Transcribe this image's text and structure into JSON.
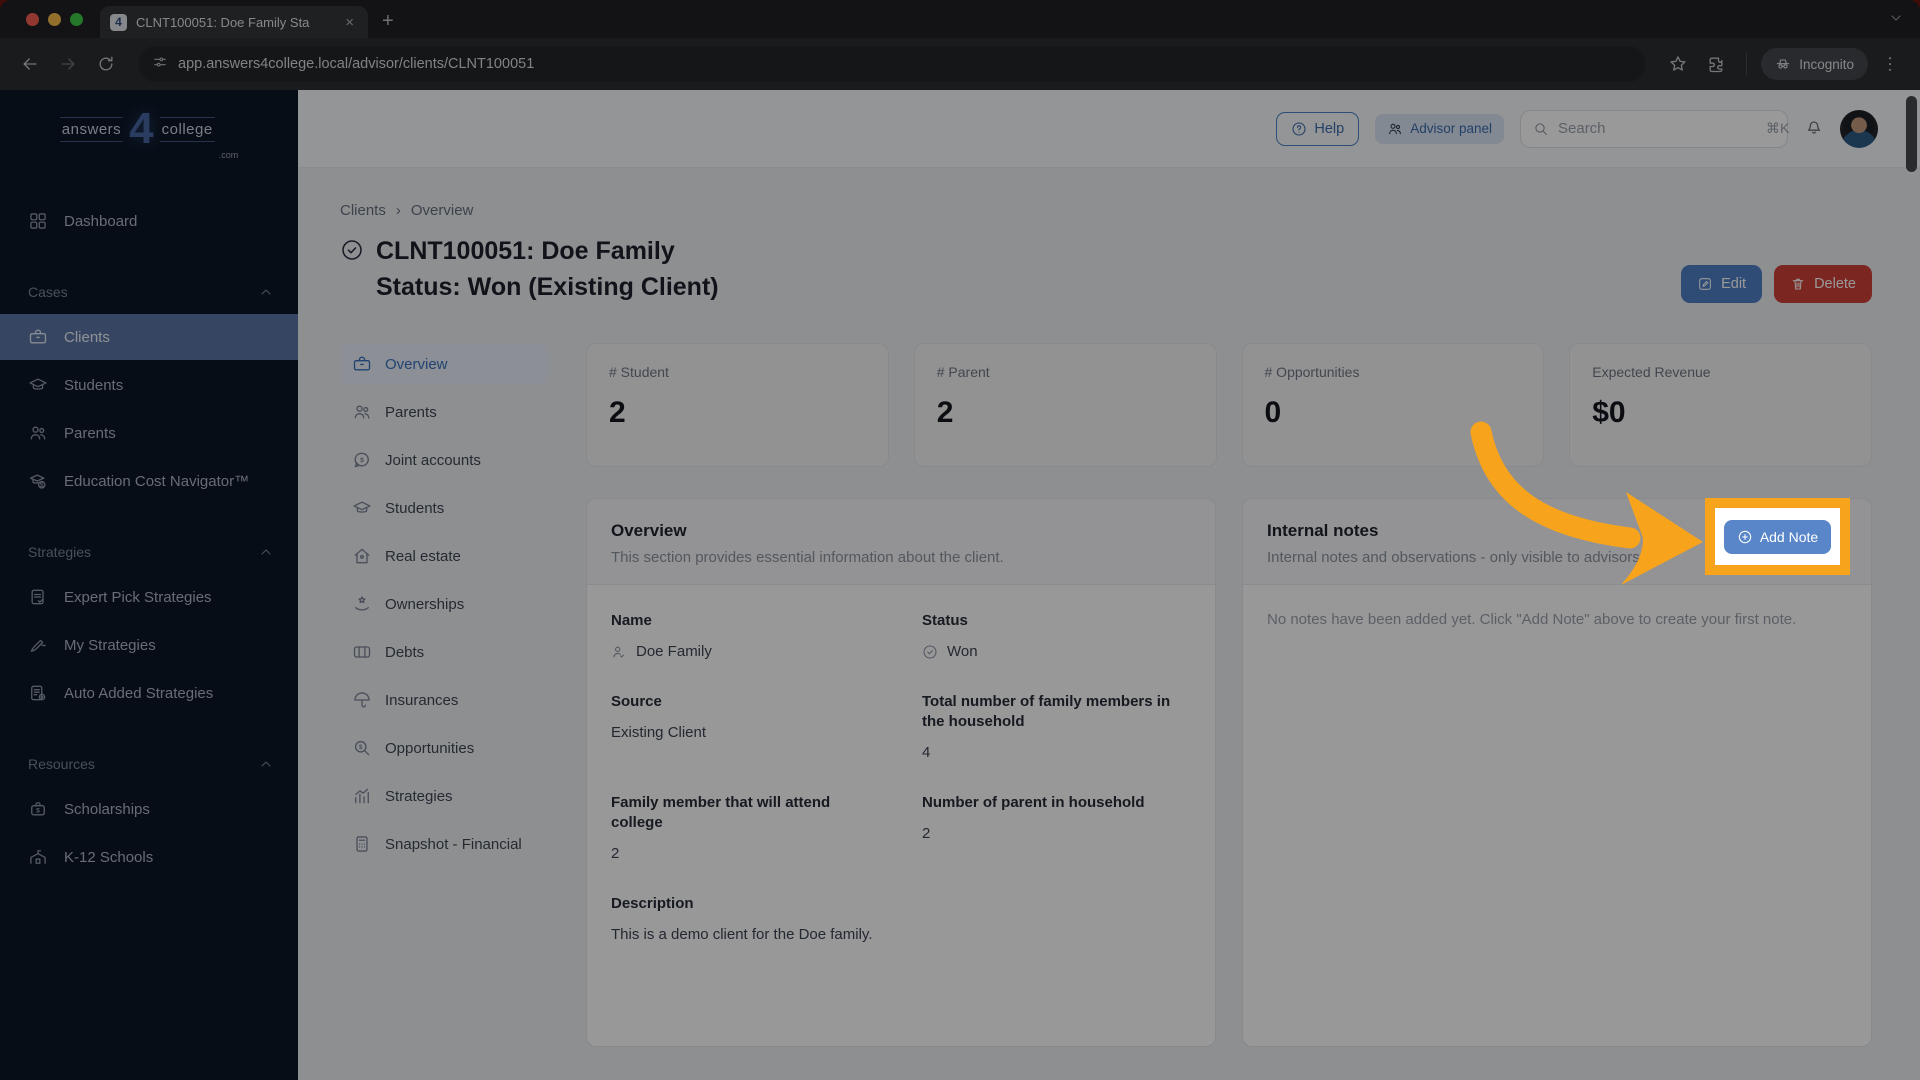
{
  "browser": {
    "tab": {
      "title": "CLNT100051: Doe Family Sta",
      "favicon_text": "4",
      "close_label": "×",
      "new_tab_label": "+"
    },
    "url": "app.answers4college.local/advisor/clients/CLNT100051",
    "incognito_label": "Incognito"
  },
  "header": {
    "logo": {
      "part1": "answers",
      "part2": "4",
      "part3": "college",
      "suffix": ".com"
    },
    "help_label": "Help",
    "advisor_panel_label": "Advisor panel",
    "search": {
      "placeholder": "Search",
      "shortcut": "⌘K"
    }
  },
  "sidebar": {
    "dashboard_label": "Dashboard",
    "sections": [
      {
        "label": "Cases",
        "items": [
          {
            "label": "Clients"
          },
          {
            "label": "Students"
          },
          {
            "label": "Parents"
          },
          {
            "label": "Education Cost Navigator™"
          }
        ]
      },
      {
        "label": "Strategies",
        "items": [
          {
            "label": "Expert Pick Strategies"
          },
          {
            "label": "My Strategies"
          },
          {
            "label": "Auto Added Strategies"
          }
        ]
      },
      {
        "label": "Resources",
        "items": [
          {
            "label": "Scholarships"
          },
          {
            "label": "K-12 Schools"
          }
        ]
      }
    ]
  },
  "main": {
    "breadcrumb": [
      "Clients",
      "Overview"
    ],
    "breadcrumb_separator": "›",
    "title_line1": "CLNT100051: Doe Family",
    "title_line2": "Status: Won (Existing Client)",
    "edit_label": "Edit",
    "delete_label": "Delete",
    "tabs": [
      {
        "label": "Overview"
      },
      {
        "label": "Parents"
      },
      {
        "label": "Joint accounts"
      },
      {
        "label": "Students"
      },
      {
        "label": "Real estate"
      },
      {
        "label": "Ownerships"
      },
      {
        "label": "Debts"
      },
      {
        "label": "Insurances"
      },
      {
        "label": "Opportunities"
      },
      {
        "label": "Strategies"
      },
      {
        "label": "Snapshot - Financial"
      }
    ],
    "stats": [
      {
        "label": "# Student",
        "value": "2"
      },
      {
        "label": "# Parent",
        "value": "2"
      },
      {
        "label": "# Opportunities",
        "value": "0"
      },
      {
        "label": "Expected Revenue",
        "value": "$0"
      }
    ],
    "overview_card": {
      "title": "Overview",
      "subtitle": "This section provides essential information about the client.",
      "fields": [
        {
          "label": "Name",
          "value": "Doe Family"
        },
        {
          "label": "Status",
          "value": "Won"
        },
        {
          "label": "Source",
          "value": "Existing Client"
        },
        {
          "label": "Total number of family members in the household",
          "value": "4"
        },
        {
          "label": "Family member that will attend college",
          "value": "2"
        },
        {
          "label": "Number of parent in household",
          "value": "2"
        },
        {
          "label": "Description",
          "value": "This is a demo client for the Doe family."
        }
      ]
    },
    "notes_card": {
      "title": "Internal notes",
      "subtitle": "Internal notes and observations - only visible to advisors.",
      "add_note_label": "Add Note",
      "empty_text": "No notes have been added yet. Click \"Add Note\" above to create your first note."
    }
  },
  "colors": {
    "accent_blue": "#4d7fc4",
    "danger_red": "#cf4038",
    "highlight_orange": "#f8a31c",
    "sidebar_bg": "#0d1726",
    "sidebar_active": "#5b76a3",
    "add_note_blue": "#5886c8"
  }
}
